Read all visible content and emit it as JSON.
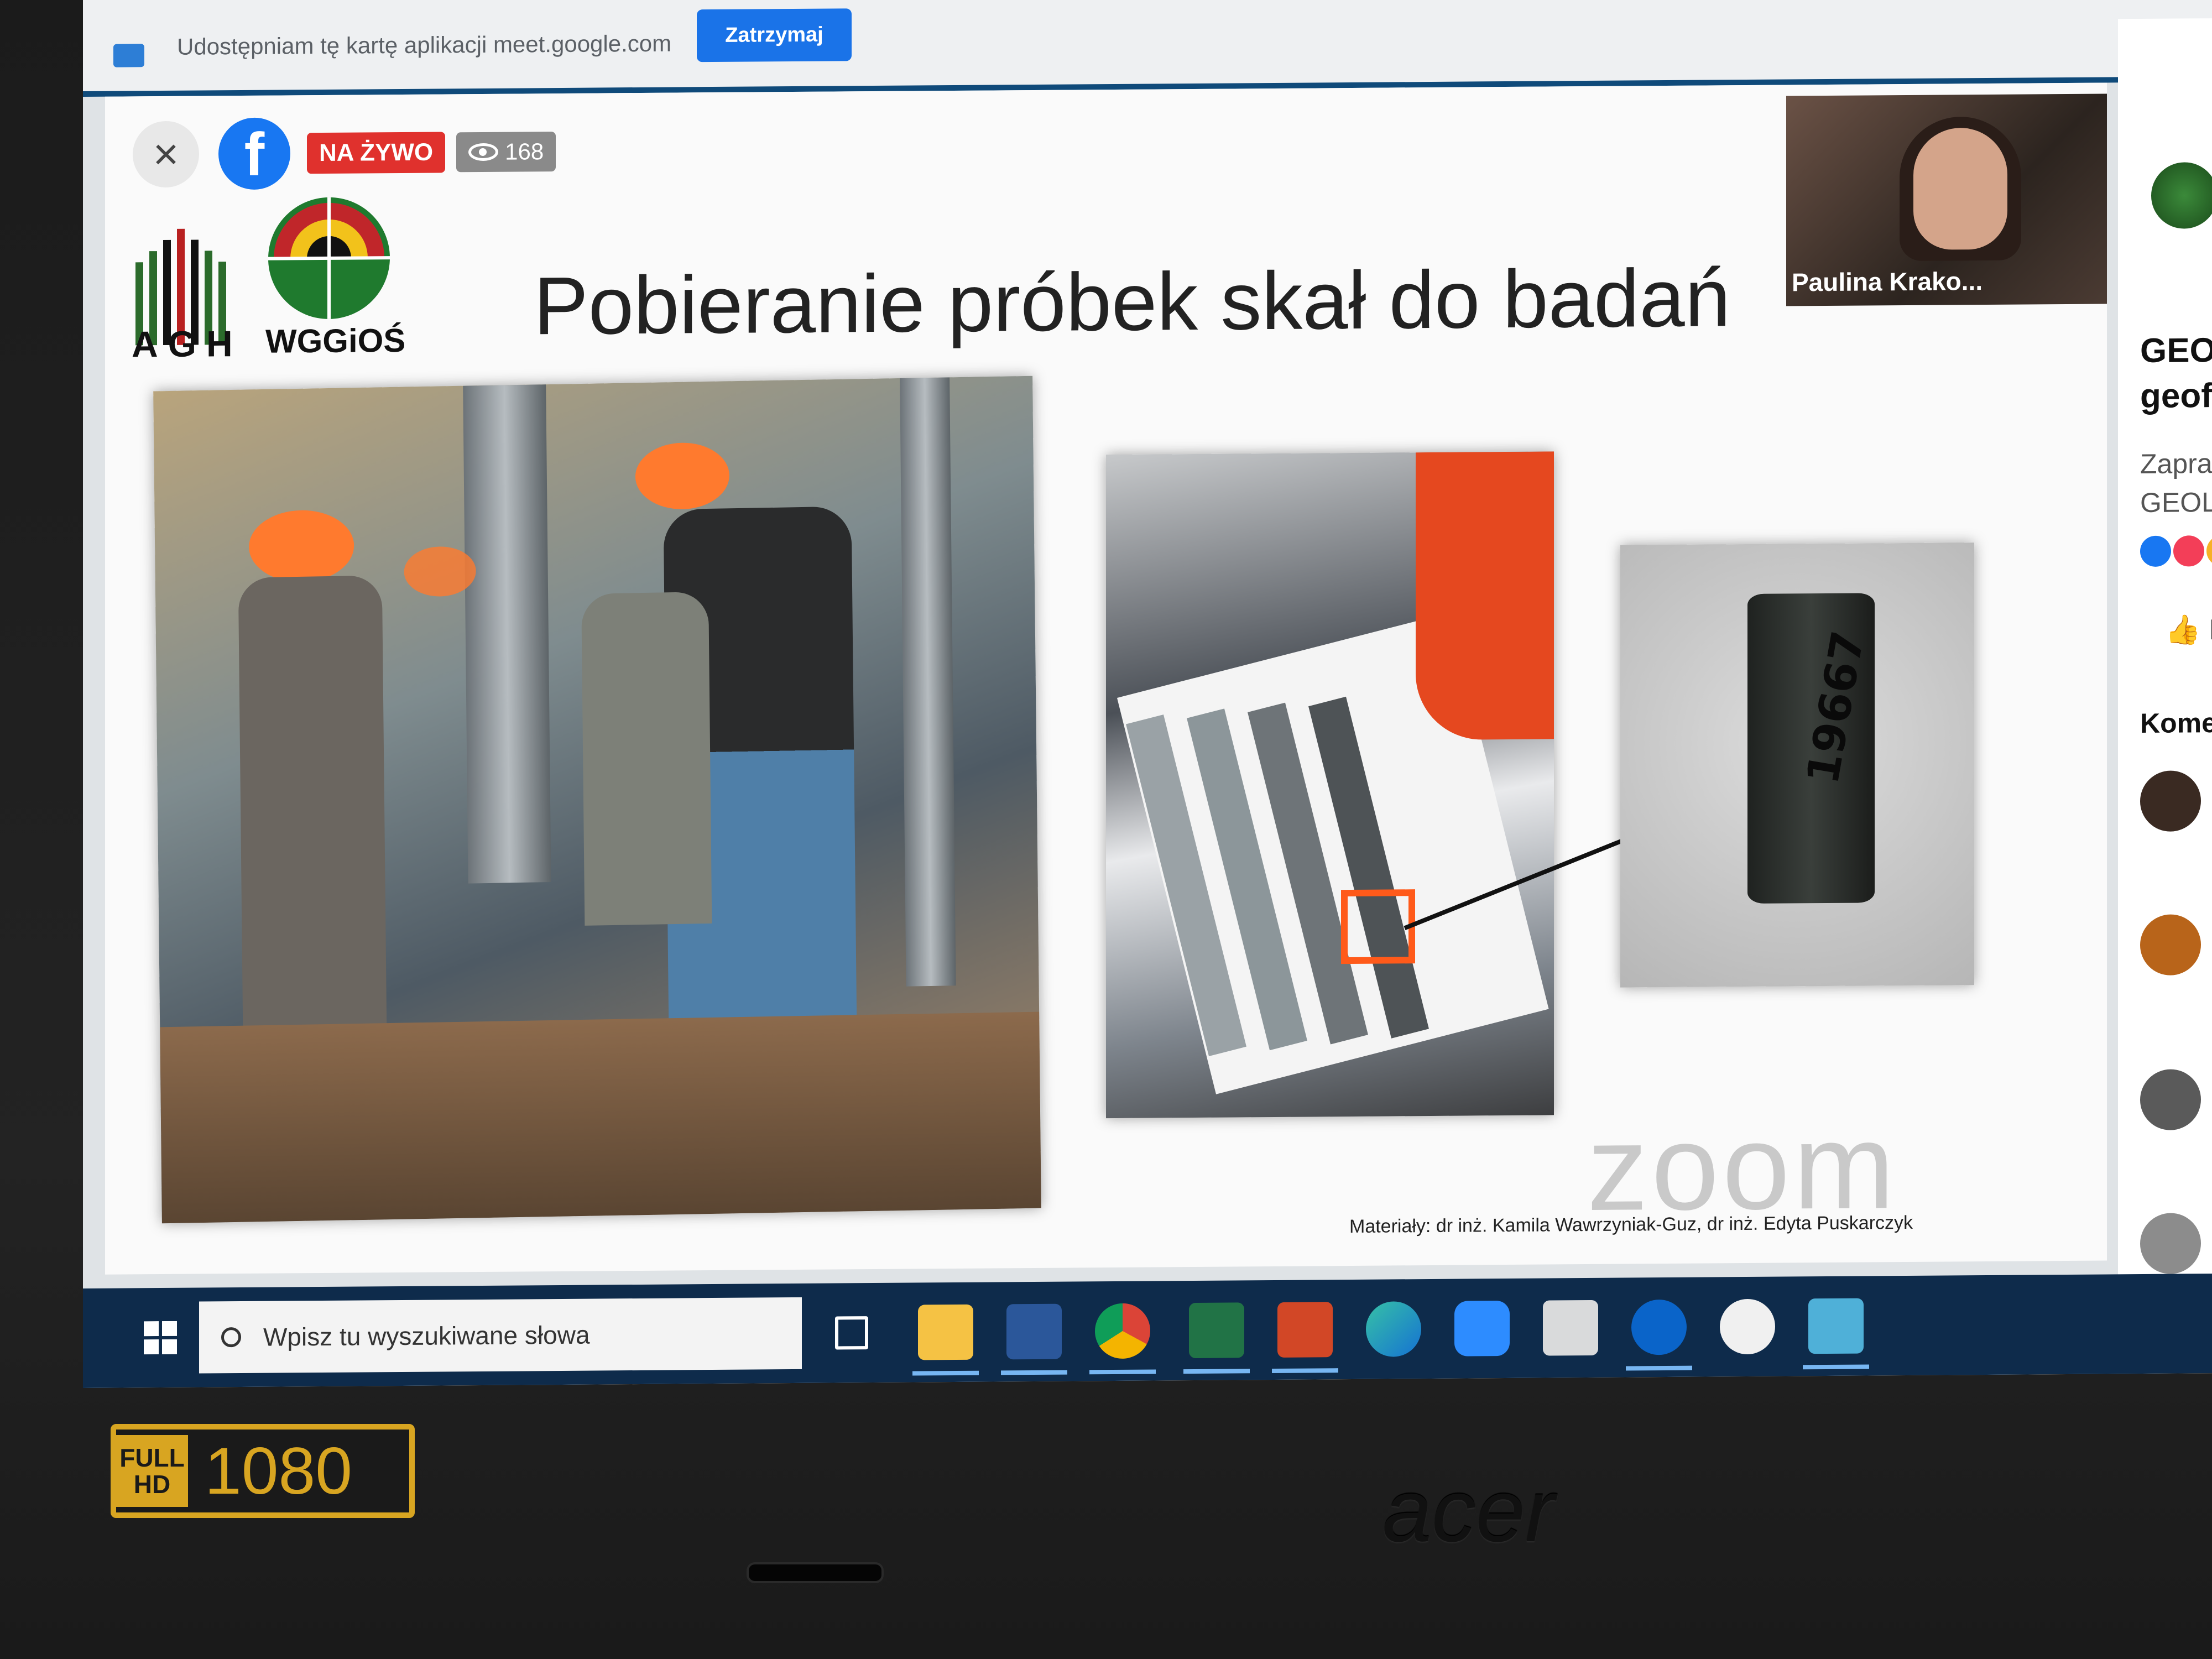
{
  "share_bar": {
    "text": "Udostępniam tę kartę aplikacji meet.google.com",
    "stop_label": "Zatrzymaj"
  },
  "live_overlay": {
    "close_symbol": "×",
    "facebook_symbol": "f",
    "live_label": "NA ŻYWO",
    "viewers": "168"
  },
  "slide": {
    "logo_agh": "AGH",
    "logo_wggios": "WGGiOŚ",
    "title": "Pobieranie próbek skał do badań",
    "sample_label": "19667",
    "zoom_watermark": "zoom",
    "credits": "Materiały: dr inż. Kamila Wawrzyniak-Guz, dr inż. Edyta Puskarczyk",
    "highlight_color": "#ff5a1a"
  },
  "presenter": {
    "name": "Paulina Krako..."
  },
  "facebook_panel": {
    "title_line1": "GEOL",
    "title_line2": "geofiz",
    "desc_line1": "Zapraszam",
    "desc_line2": "GEOLEK",
    "like_label": "Lu",
    "comments_label": "Koment"
  },
  "taskbar": {
    "search_placeholder": "Wpisz tu wyszukiwane słowa",
    "apps": [
      "task-view",
      "file-explorer",
      "word",
      "chrome",
      "excel",
      "powerpoint",
      "edge",
      "zoom",
      "printer",
      "outlook",
      "paint",
      "installer"
    ]
  },
  "laptop": {
    "badge_full": "FULL",
    "badge_hd": "HD",
    "badge_resolution": "1080",
    "brand": "acer"
  },
  "colors": {
    "accent_blue": "#1a73e8",
    "live_red": "#e0312d",
    "taskbar": "#0e2b4b",
    "badge_gold": "#d8a521"
  }
}
